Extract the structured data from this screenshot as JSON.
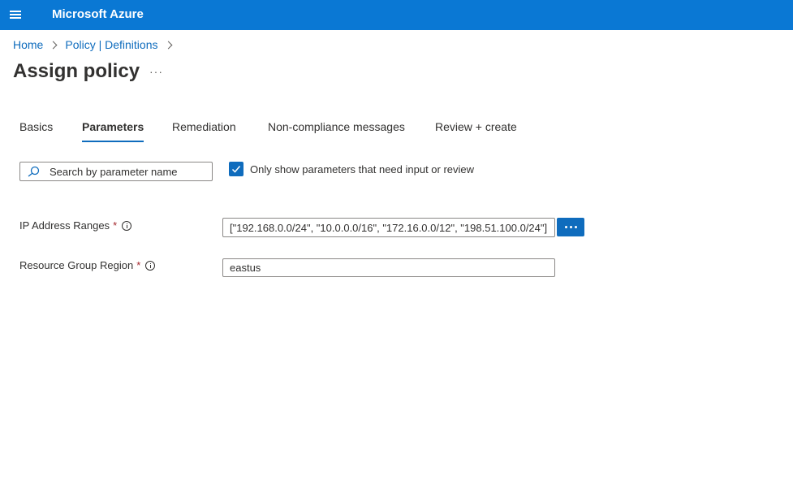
{
  "header": {
    "menu_icon": "hamburger-icon",
    "brand": "Microsoft Azure"
  },
  "breadcrumb": {
    "items": [
      "Home",
      "Policy | Definitions"
    ]
  },
  "page": {
    "title": "Assign policy",
    "more_label": "···"
  },
  "tabs": [
    {
      "label": "Basics",
      "active": false
    },
    {
      "label": "Parameters",
      "active": true
    },
    {
      "label": "Remediation",
      "active": false
    },
    {
      "label": "Non-compliance messages",
      "active": false
    },
    {
      "label": "Review + create",
      "active": false
    }
  ],
  "filter": {
    "search_placeholder": "Search by parameter name",
    "search_value": "",
    "checkbox_checked": true,
    "checkbox_label": "Only show parameters that need input or review"
  },
  "parameters": [
    {
      "label": "IP Address Ranges",
      "required_mark": "*",
      "value": "[\"192.168.0.0/24\", \"10.0.0.0/16\", \"172.16.0.0/12\", \"198.51.100.0/24\"]"
    },
    {
      "label": "Resource Group Region",
      "required_mark": "*",
      "value": "eastus"
    }
  ],
  "colors": {
    "topbar": "#0a78d4",
    "accent": "#0f6cbd",
    "required": "#a4262c"
  }
}
